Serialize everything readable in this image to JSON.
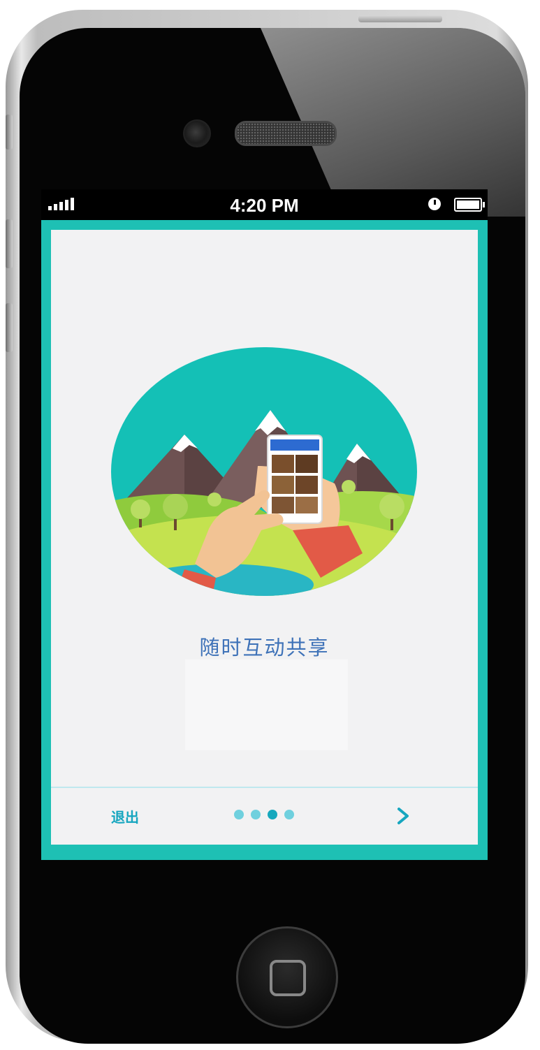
{
  "status_bar": {
    "time": "4:20 PM",
    "signal_icon": "signal-bars-icon",
    "alarm_icon": "clock-icon",
    "battery_icon": "battery-icon"
  },
  "onboarding": {
    "caption": "随时互动共享",
    "exit_label": "退出",
    "page_indicator": {
      "total": 4,
      "current": 3
    },
    "next_icon": "chevron-right-icon"
  },
  "colors": {
    "frame_teal": "#1ec0b4",
    "caption_blue": "#3e72b8",
    "accent": "#16a6bf",
    "screen_bg": "#f2f2f3"
  }
}
